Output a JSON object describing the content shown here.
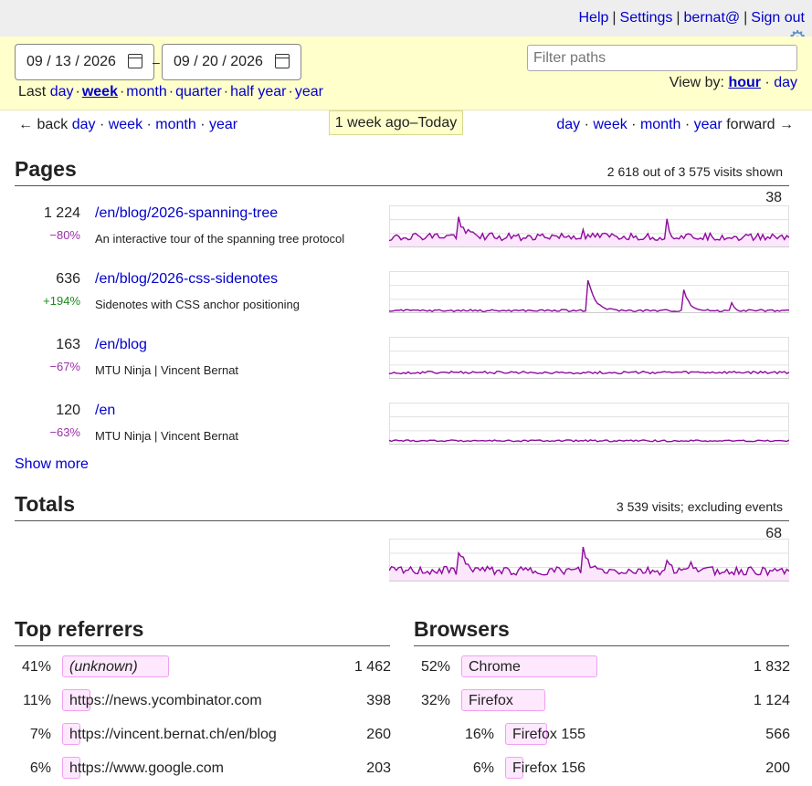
{
  "topbar": {
    "links": [
      "Help",
      "Settings",
      "bernat@",
      "Sign out"
    ],
    "gear_icon": "gear-icon"
  },
  "filters": {
    "date_from": "09 / 13 / 2026",
    "date_to": "09 / 20 / 2026",
    "dash": "–",
    "last_label": "Last",
    "ranges": [
      "day",
      "week",
      "month",
      "quarter",
      "half year",
      "year"
    ],
    "ranges_current": "week",
    "filter_placeholder": "Filter paths",
    "viewby_label": "View by:",
    "viewby_options": [
      "hour",
      "day"
    ],
    "viewby_current": "hour"
  },
  "nav": {
    "back_arrow": "← back",
    "back_links": [
      "day",
      "week",
      "month",
      "year"
    ],
    "forward_links": [
      "day",
      "week",
      "month",
      "year"
    ],
    "forward_arrow": "forward →",
    "range_badge": "1 week ago–Today"
  },
  "pages": {
    "title": "Pages",
    "note": "2 618 out of 3 575 visits shown",
    "chart_max": "38",
    "rows": [
      {
        "count": "1 224",
        "change": "−80%",
        "change_kind": "neg",
        "path": "/en/blog/2026-spanning-tree",
        "desc": "An interactive tour of the spanning tree protocol"
      },
      {
        "count": "636",
        "change": "+194%",
        "change_kind": "pos",
        "path": "/en/blog/2026-css-sidenotes",
        "desc": "Sidenotes with CSS anchor positioning"
      },
      {
        "count": "163",
        "change": "−67%",
        "change_kind": "neg",
        "path": "/en/blog",
        "desc": "MTU Ninja | Vincent Bernat"
      },
      {
        "count": "120",
        "change": "−63%",
        "change_kind": "neg",
        "path": "/en",
        "desc": "MTU Ninja | Vincent Bernat"
      }
    ],
    "show_more": "Show more"
  },
  "totals": {
    "title": "Totals",
    "note": "3 539 visits; excluding events",
    "chart_max": "68"
  },
  "referrers": {
    "title": "Top referrers",
    "rows": [
      {
        "pct": "41%",
        "frac": 0.41,
        "name": "(unknown)",
        "italic": true,
        "value": "1 462"
      },
      {
        "pct": "11%",
        "frac": 0.11,
        "name": "https://news.ycombinator.com",
        "italic": false,
        "value": "398"
      },
      {
        "pct": "7%",
        "frac": 0.07,
        "name": "https://vincent.bernat.ch/en/blog",
        "italic": false,
        "value": "260"
      },
      {
        "pct": "6%",
        "frac": 0.06,
        "name": "https://www.google.com",
        "italic": false,
        "value": "203"
      }
    ]
  },
  "browsers": {
    "title": "Browsers",
    "rows": [
      {
        "pct": "52%",
        "frac": 0.52,
        "name": "Chrome",
        "value": "1 832",
        "indent": false
      },
      {
        "pct": "32%",
        "frac": 0.32,
        "name": "Firefox",
        "value": "1 124",
        "indent": false
      },
      {
        "pct": "16%",
        "frac": 0.16,
        "name": "Firefox 155",
        "value": "566",
        "indent": true
      },
      {
        "pct": "6%",
        "frac": 0.06,
        "name": "Firefox 156",
        "value": "200",
        "indent": true
      }
    ]
  },
  "colors": {
    "link": "#0000cc",
    "line": "#8e0a9e",
    "fill": "#fbe6fb",
    "panel": "#ffffcc",
    "negative": "#9b2fa8",
    "positive": "#1a8a1a"
  }
}
